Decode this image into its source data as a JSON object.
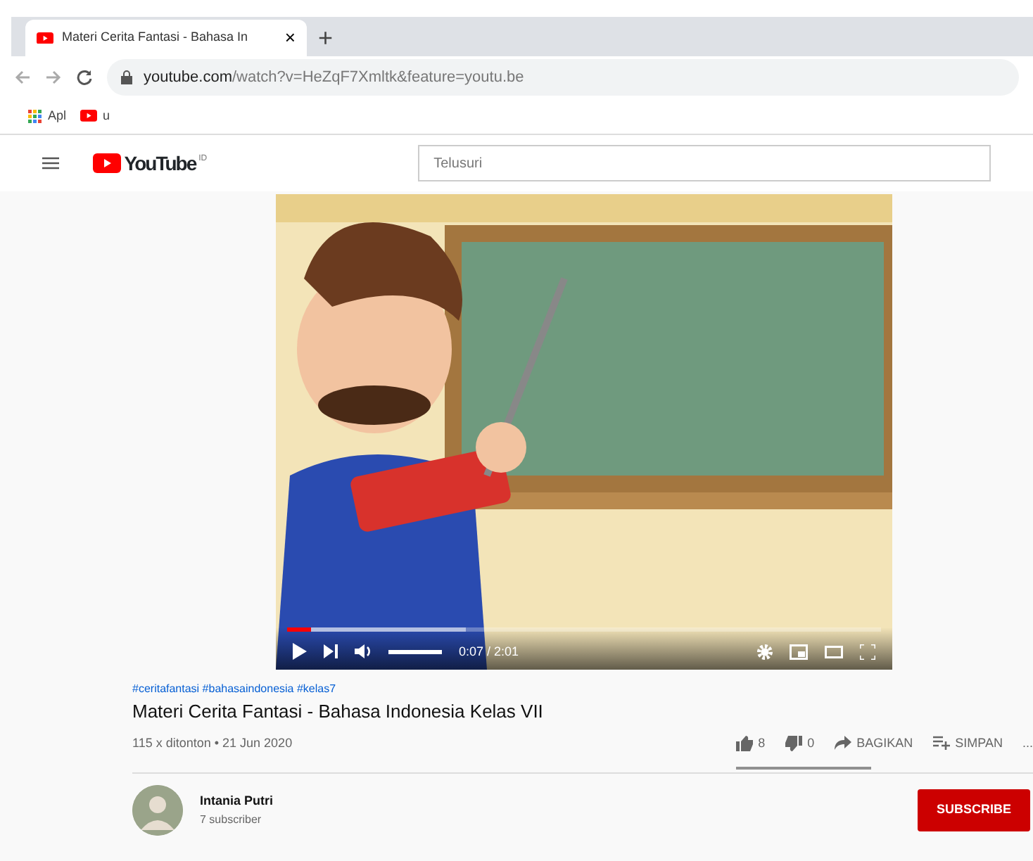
{
  "browser": {
    "tab": {
      "title": "Materi Cerita Fantasi - Bahasa In",
      "selected": true,
      "close": "×"
    },
    "new_tab": "+",
    "url_host": "youtube.com",
    "url_path": "/watch?v=HeZqF7Xmltk&feature=youtu.be",
    "bookmarks": [
      {
        "kind": "apps",
        "label": "Apl"
      },
      {
        "kind": "youtube",
        "label": "u"
      }
    ]
  },
  "header": {
    "logo": "YouTube",
    "logo_mark": "ID",
    "search": {
      "placeholder": "Telusuri"
    }
  },
  "player": {
    "kind": "picture",
    "progress": {
      "level": 0.04
    },
    "volume": {
      "level": 1
    },
    "time": "0:07 / 2:01"
  },
  "video": {
    "hashtags": "#ceritafantasi #bahasaindonesia #kelas7",
    "title": "Materi Cerita Fantasi - Bahasa Indonesia Kelas VII",
    "meta": "115 x ditonton • 21 Jun 2020",
    "actions": [
      {
        "kind": "like",
        "label": "8"
      },
      {
        "kind": "dislike",
        "label": "0"
      },
      {
        "kind": "share",
        "label": "BAGIKAN"
      },
      {
        "kind": "save",
        "label": "SIMPAN"
      },
      {
        "kind": "more",
        "label": "..."
      }
    ],
    "like_ratio": {
      "level": 1
    }
  },
  "channel": {
    "name": "Intania Putri",
    "subscribers": "7 subscriber",
    "subscribe": "SUBSCRIBE"
  }
}
